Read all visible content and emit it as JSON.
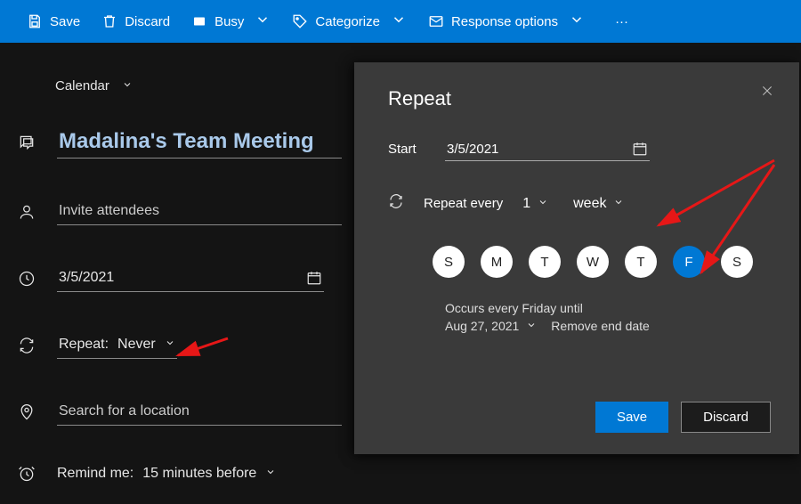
{
  "toolbar": {
    "save": "Save",
    "discard": "Discard",
    "busy": "Busy",
    "categorize": "Categorize",
    "response_options": "Response options",
    "more": "···"
  },
  "form": {
    "calendar_label": "Calendar",
    "title": "Madalina's Team Meeting",
    "attendees_placeholder": "Invite attendees",
    "date": "3/5/2021",
    "repeat_label": "Repeat:",
    "repeat_value": "Never",
    "location_placeholder": "Search for a location",
    "remind_label": "Remind me:",
    "remind_value": "15 minutes before"
  },
  "dialog": {
    "title": "Repeat",
    "start_label": "Start",
    "start_date": "3/5/2021",
    "repeat_every_label": "Repeat every",
    "interval": "1",
    "unit": "week",
    "days": [
      "S",
      "M",
      "T",
      "W",
      "T",
      "F",
      "S"
    ],
    "selected_day_index": 5,
    "occurs_text": "Occurs every Friday until",
    "end_date": "Aug 27, 2021",
    "remove_end": "Remove end date",
    "save": "Save",
    "discard": "Discard"
  }
}
